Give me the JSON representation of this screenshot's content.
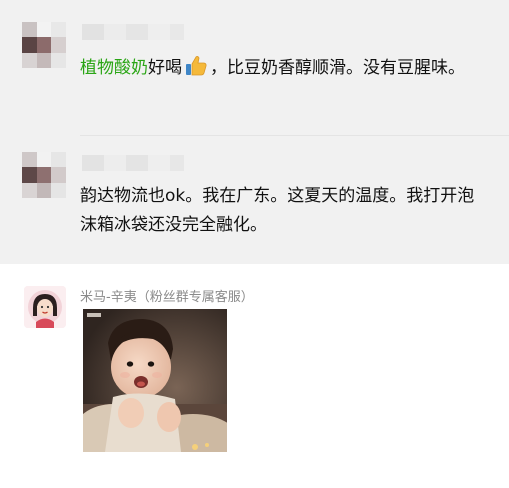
{
  "comments": [
    {
      "highlight": "植物酸奶",
      "text_before_emoji": "好喝",
      "emoji": "thumbs-up-icon",
      "text_after_emoji": "，比豆奶香醇顺滑。没有豆腥味。"
    },
    {
      "text": "韵达物流也ok。我在广东。这夏天的温度。我打开泡沫箱冰袋还没完全融化。"
    },
    {
      "sender": "米马-辛夷（粉丝群专属客服）",
      "image": "baby-photo"
    }
  ],
  "colors": {
    "link_green": "#2aa515",
    "name_gray": "#8a8a8a",
    "bg_gray": "#f1f1f1"
  }
}
